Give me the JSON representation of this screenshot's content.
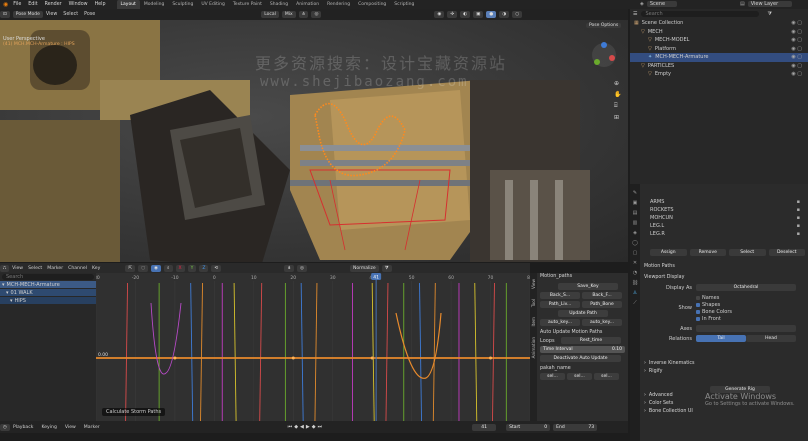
{
  "topbar": {
    "menus": [
      "File",
      "Edit",
      "Render",
      "Window",
      "Help"
    ],
    "workspaces": [
      "Layout",
      "Modeling",
      "Sculpting",
      "UV Editing",
      "Texture Paint",
      "Shading",
      "Animation",
      "Rendering",
      "Compositing",
      "Scripting"
    ],
    "active_workspace": "Layout",
    "scene": "Scene",
    "view_layer": "View Layer"
  },
  "viewport": {
    "mode": "Pose Mode",
    "menus": [
      "View",
      "Select",
      "Pose"
    ],
    "transform": "Local",
    "pivot": "Mix",
    "pose_options": "Pose Options",
    "overlay_title": "User Perspective",
    "overlay_sub": "(41) MCH.MCH-Armature : HIPS"
  },
  "watermark": {
    "line1": "更多资源搜索：设计宝藏资源站",
    "line2": "www.shejibaozang.com"
  },
  "outliner": {
    "search_placeholder": "Search",
    "items": [
      {
        "label": "Scene Collection",
        "indent": 0
      },
      {
        "label": "MECH",
        "indent": 1
      },
      {
        "label": "MECH-MODEL",
        "indent": 2
      },
      {
        "label": "Platform",
        "indent": 2
      },
      {
        "label": "MCH-MECH-Armature",
        "indent": 2,
        "selected": true
      },
      {
        "label": "PARTICLES",
        "indent": 1
      },
      {
        "label": "Empty",
        "indent": 2
      }
    ]
  },
  "properties": {
    "bone_groups": [
      "ARMS",
      "ROCKETS",
      "MOHCUN",
      "LEG.L",
      "LEG.R"
    ],
    "buttons": [
      "Assign",
      "Remove",
      "Select",
      "Deselect"
    ],
    "sections": [
      "Motion Paths",
      "Viewport Display"
    ],
    "display_as_label": "Display As",
    "display_as_value": "Octahedral",
    "show_label": "Show",
    "show_options": [
      "Names",
      "Shapes",
      "Bone Colors",
      "In Front"
    ],
    "axes_label": "Axes",
    "relations_label": "Relations",
    "relations_options": [
      "Tail",
      "Head"
    ],
    "more_sections": [
      "Inverse Kinematics",
      "Rigify",
      "Advanced",
      "Color Sets",
      "Bone Collection UI"
    ],
    "generate_button": "Generate Rig"
  },
  "activate_windows": {
    "title": "Activate Windows",
    "sub": "Go to Settings to activate Windows."
  },
  "graph_editor": {
    "menus": [
      "View",
      "Select",
      "Marker",
      "Channel",
      "Key"
    ],
    "normalize": "Normalize",
    "frame_ticks": [
      "-30",
      "-20",
      "-10",
      "0",
      "10",
      "20",
      "30",
      "40",
      "50",
      "60",
      "70",
      "80"
    ],
    "current_frame": "41",
    "value_label": "0.00",
    "tooltip": "Calculate Storm Paths",
    "channels": [
      {
        "label": "MCH-MECH-Armature",
        "indent": 0
      },
      {
        "label": "01 WALK",
        "indent": 1
      },
      {
        "label": "HIPS",
        "indent": 2
      }
    ],
    "search_placeholder": "Search"
  },
  "npanel": {
    "sections": [
      "Motion_paths",
      "Auto Update Motion Paths",
      "pakah_name"
    ],
    "buttons": [
      "Save_Key",
      "Back_S...",
      "Back_F...",
      "Path_Liv...",
      "Path_Bone",
      "Update Path",
      "auto_key...",
      "auto_key..."
    ],
    "label1": "Loops",
    "value1": "Rest_time",
    "label2": "Time Interval",
    "value2": "0.10",
    "deactivate": "Deactivate Auto Update",
    "small_buttons": [
      "sel...",
      "sel...",
      "sel..."
    ],
    "tabs": [
      "View",
      "Tool",
      "Item",
      "Animation"
    ]
  },
  "playback": {
    "menus": [
      "Playback",
      "Keying",
      "View",
      "Marker"
    ],
    "current_frame": "41",
    "start_label": "Start",
    "start": "0",
    "end_label": "End",
    "end": "73"
  },
  "chart_data": {
    "type": "line",
    "x_range": [
      -30,
      80
    ],
    "series": [
      {
        "values": [
          [
            -10,
            0
          ],
          [
            20,
            0
          ],
          [
            40,
            0
          ],
          [
            70,
            0
          ]
        ]
      }
    ]
  },
  "colors": {
    "accent": "#4772b3",
    "selection": "#e88a2c",
    "header_bg": "#232323"
  }
}
